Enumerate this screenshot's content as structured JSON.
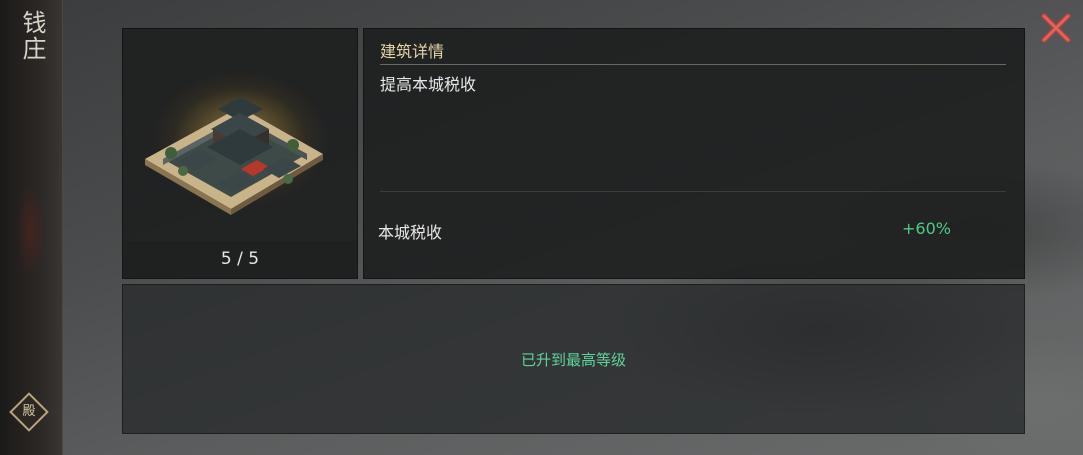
{
  "building": {
    "name": "钱庄",
    "level_text": "5 / 5",
    "level_current": 5,
    "level_max": 5
  },
  "details": {
    "header": "建筑详情",
    "description": "提高本城税收",
    "stats": [
      {
        "label": "本城税收",
        "value": "+60%"
      }
    ]
  },
  "status": {
    "message": "已升到最高等级"
  },
  "seal_char": "殿",
  "icons": {
    "close": "close-icon",
    "building": "building-illustration",
    "seal": "seal-icon"
  },
  "colors": {
    "accent_gold": "#e6d5a8",
    "stat_green": "#4fcb86",
    "close_red": "#c8443c"
  }
}
